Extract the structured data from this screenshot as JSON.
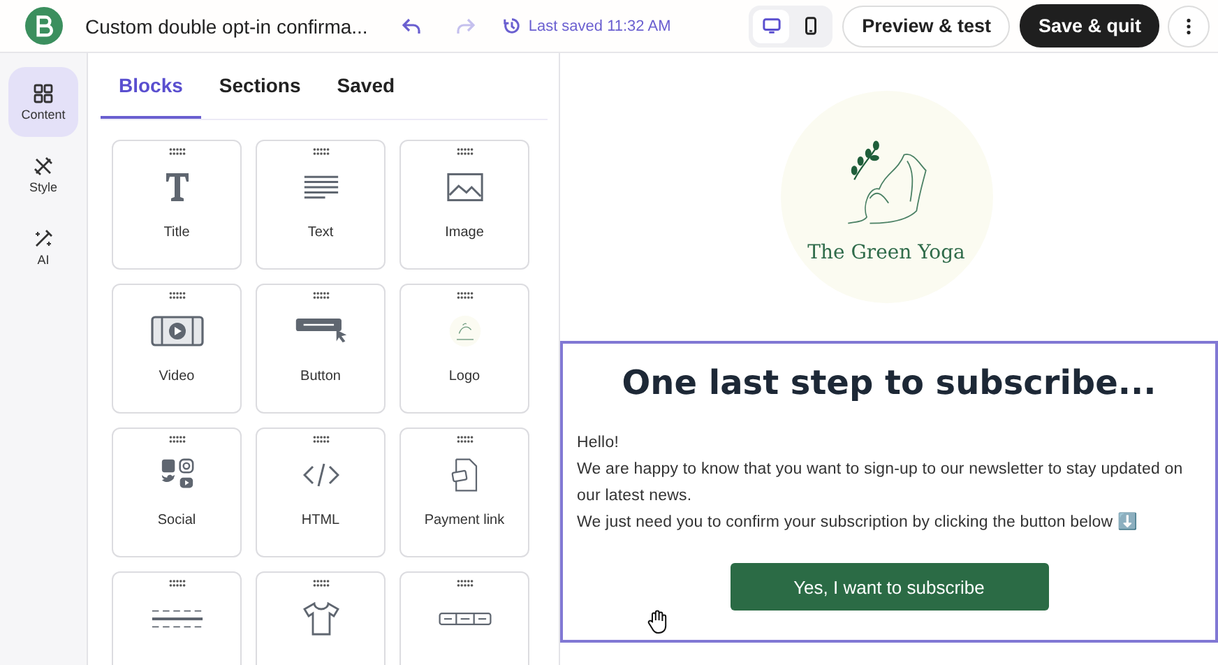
{
  "header": {
    "title": "Custom double opt-in confirma...",
    "last_saved": "Last saved 11:32 AM",
    "devices": [
      {
        "kind": "desktop",
        "selected": true
      },
      {
        "kind": "mobile",
        "selected": false
      }
    ],
    "preview_button": "Preview & test",
    "save_button": "Save & quit"
  },
  "rail": [
    {
      "kind": "content",
      "label": "Content",
      "selected": true
    },
    {
      "kind": "style",
      "label": "Style",
      "selected": false
    },
    {
      "kind": "ai",
      "label": "AI",
      "selected": false
    }
  ],
  "tabs": [
    {
      "label": "Blocks",
      "selected": true
    },
    {
      "label": "Sections",
      "selected": false
    },
    {
      "label": "Saved",
      "selected": false
    }
  ],
  "blocks": [
    {
      "kind": "title",
      "label": "Title"
    },
    {
      "kind": "text",
      "label": "Text"
    },
    {
      "kind": "image",
      "label": "Image"
    },
    {
      "kind": "video",
      "label": "Video"
    },
    {
      "kind": "button",
      "label": "Button"
    },
    {
      "kind": "logo",
      "label": "Logo"
    },
    {
      "kind": "social",
      "label": "Social"
    },
    {
      "kind": "html",
      "label": "HTML"
    },
    {
      "kind": "payment",
      "label": "Payment link"
    },
    {
      "kind": "divider"
    },
    {
      "kind": "product"
    },
    {
      "kind": "navigation"
    }
  ],
  "email": {
    "logo_text": "The Green Yoga",
    "heading": "One last step to subscribe...",
    "paragraphs": [
      "Hello!",
      "We are happy to know that you want to sign-up to our newsletter to stay updated on our latest news.",
      "We just need you to confirm your subscription by clicking the button below ⬇️"
    ],
    "button": "Yes, I want to subscribe"
  }
}
